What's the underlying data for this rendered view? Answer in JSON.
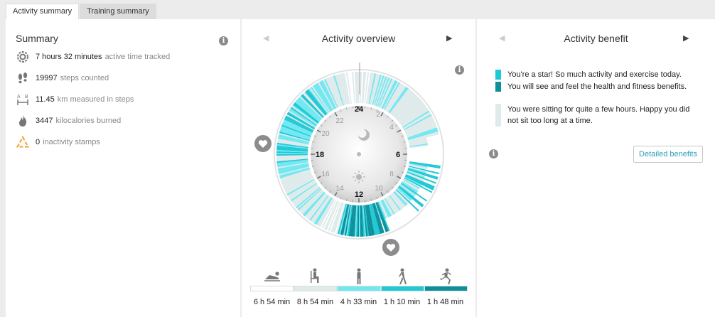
{
  "tabs": [
    {
      "label": "Activity summary",
      "active": true
    },
    {
      "label": "Training summary",
      "active": false
    }
  ],
  "summary": {
    "title": "Summary",
    "rows": [
      {
        "icon": "clock-icon",
        "value": "7 hours 32 minutes",
        "label": "active time tracked"
      },
      {
        "icon": "footprints-icon",
        "value": "19997",
        "label": "steps counted"
      },
      {
        "icon": "distance-icon",
        "value": "11.45",
        "label": "km measured in steps"
      },
      {
        "icon": "flame-icon",
        "value": "3447",
        "label": "kilocalories burned"
      },
      {
        "icon": "inactivity-stamp-icon",
        "value": "0",
        "label": "inactivity stamps"
      }
    ]
  },
  "overview": {
    "title": "Activity overview",
    "clock_labels": {
      "h24": "24",
      "h2": "2",
      "h4": "4",
      "h6": "6",
      "h8": "8",
      "h10": "10",
      "h12": "12",
      "h14": "14",
      "h16": "16",
      "h18": "18",
      "h20": "20",
      "h22": "22"
    },
    "levels": [
      {
        "name": "resting",
        "icon": "lying-person-icon",
        "color": "#ffffff",
        "duration": "6 h 54 min"
      },
      {
        "name": "sitting",
        "icon": "sitting-person-icon",
        "color": "#dfeaea",
        "duration": "8 h 54 min"
      },
      {
        "name": "low",
        "icon": "standing-person-icon",
        "color": "#6fe8f2",
        "duration": "4 h 33 min"
      },
      {
        "name": "medium",
        "icon": "walking-person-icon",
        "color": "#1ec8d4",
        "duration": "1 h 10 min"
      },
      {
        "name": "high",
        "icon": "running-person-icon",
        "color": "#0c8f9a",
        "duration": "1 h 48 min"
      }
    ]
  },
  "benefit": {
    "title": "Activity benefit",
    "items": [
      {
        "color": "#1ec8d4",
        "text": "You're a star! So much activity and exercise today."
      },
      {
        "color": "#0c8f9a",
        "text": "You will see and feel the health and fitness benefits."
      },
      {
        "color": "#dfeaea",
        "text": "You were sitting for quite a few hours. Happy you did not sit too long at a time."
      }
    ],
    "button_label": "Detailed benefits"
  }
}
